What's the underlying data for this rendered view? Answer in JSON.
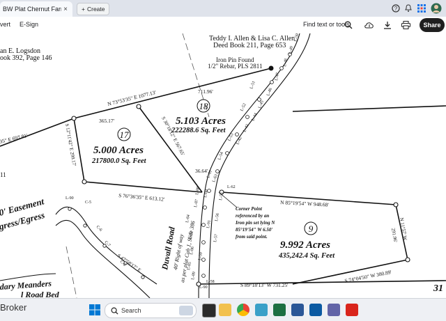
{
  "browser": {
    "tab_title": "BW Plat Chernut Farms ...",
    "tab_close": "×",
    "create_label": "Create",
    "create_plus": "+"
  },
  "toolbar": {
    "convert_label": "vert",
    "esign_label": "E-Sign",
    "find_label": "Find text or tools",
    "share_label": "Share"
  },
  "plat": {
    "owner_left_line1": "an E. Logsdon",
    "owner_left_line2": "ook 392, Page 146",
    "owner_top_line1": "Teddy I. Allen & Lisa C. Allen",
    "owner_top_line2": "Deed Book 211, Page 653",
    "iron_pin_line1": "Iron Pin Found",
    "iron_pin_line2": "1/2\" Rebar, PLS 2811",
    "bearing_top": "N 73°53'35\" E  1077.13'",
    "dist_711": "711.96'",
    "dist_365": "365.17'",
    "bearing_left": "35\" E  697.81'",
    "bearing_w17": "S 12°11'42\" E  299.17'",
    "bearing_s30": "S 30°18'12\" E  567.65'",
    "dist_3664": "36.64'",
    "lot17_num": "17",
    "lot17_acres": "5.000 Acres",
    "lot17_sqft": "217800.0 Sq. Feet",
    "lot18_num": "18",
    "lot18_acres": "5.103 Acres",
    "lot18_sqft": "222288.6 Sq. Feet",
    "lot9_num": "9",
    "lot9_acres": "9.992 Acres",
    "lot9_sqft": "435,242.4 Sq. Feet",
    "bearing_s76": "S 76°36'35\" E  613.12'",
    "bearing_n85": "N 85°19'54\" W  948.68'",
    "bearing_n11": "N 11°57' W",
    "dist_29196": "291.96'",
    "bearing_s74": "S 74°04'50\" W  380.89'",
    "bearing_s89": "S 89°18'13\" W  731.25'",
    "bearing_s47": "S 47°58'17\" E",
    "easement_line1": "0' Easement",
    "easement_line2": "gress/Egress",
    "meanders_line1": "dary Meanders",
    "meanders_line2": "l Road Bed",
    "duvall_road": "Duvall Road",
    "row_line1": "40' Right of way",
    "row_line2": "as per plat Cab 1, Slide 386",
    "corner_note_1": "Corner Point",
    "corner_note_2": "referenced by an",
    "corner_note_3": "Iron pin set lying N",
    "corner_note_4": "85°19'54\" W  6.50'",
    "corner_note_5": "from said point.",
    "left_num": "11",
    "right_num": "31",
    "line_labels": [
      "L-50",
      "L-49",
      "L-48",
      "L-47",
      "L-46",
      "L-45",
      "L-44",
      "L-43",
      "L-42",
      "L-61",
      "L-63",
      "L-62",
      "L-60",
      "L-59",
      "L-58",
      "L-57",
      "L-56",
      "L-55",
      "L-54",
      "L-53",
      "L-52",
      "L-51",
      "C-5",
      "L-90",
      "C-6",
      "C-7",
      "C-8",
      "L-84",
      "L-83",
      "L-85",
      "L-86",
      "L-87",
      "L-88",
      "L-89",
      "L-90",
      "L-91"
    ]
  },
  "taskbar": {
    "left_label": "Broker",
    "search_label": "Search"
  }
}
